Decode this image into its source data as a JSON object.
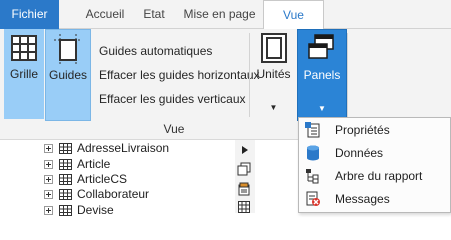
{
  "tabs": [
    {
      "label": "Fichier"
    },
    {
      "label": "Accueil"
    },
    {
      "label": "Etat"
    },
    {
      "label": "Mise en page"
    },
    {
      "label": "Vue"
    }
  ],
  "ribbon": {
    "grille": "Grille",
    "guides": "Guides",
    "commands": [
      "Guides automatiques",
      "Effacer les guides horizontaux",
      "Effacer les guides verticaux"
    ],
    "unites": "Unités",
    "panels": "Panels",
    "group_label": "Vue"
  },
  "tree": {
    "items": [
      "AdresseLivraison",
      "Article",
      "ArticleCS",
      "Collaborateur",
      "Devise"
    ]
  },
  "menu": {
    "items": [
      {
        "label": "Propriétés",
        "icon": "properties-icon"
      },
      {
        "label": "Données",
        "icon": "database-icon"
      },
      {
        "label": "Arbre du rapport",
        "icon": "report-tree-icon"
      },
      {
        "label": "Messages",
        "icon": "messages-icon"
      }
    ]
  },
  "colors": {
    "accent": "#2b79c9",
    "selected": "#99cdf7",
    "panels": "#2b84d6"
  }
}
